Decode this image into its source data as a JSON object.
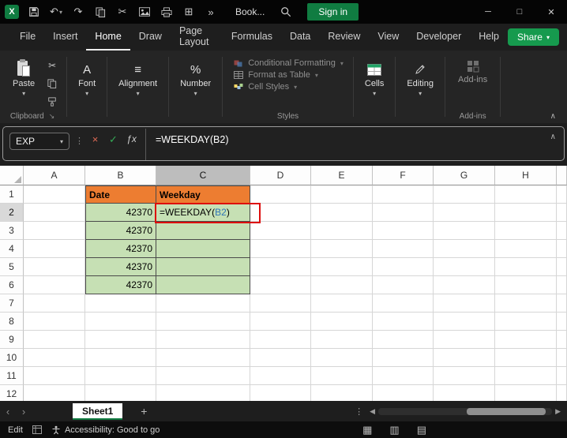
{
  "titlebar": {
    "workbook_name": "Book...",
    "signin_label": "Sign in"
  },
  "menubar": {
    "items": [
      "File",
      "Insert",
      "Home",
      "Draw",
      "Page Layout",
      "Formulas",
      "Data",
      "Review",
      "View",
      "Developer",
      "Help"
    ],
    "active": "Home",
    "share_label": "Share"
  },
  "ribbon": {
    "paste_label": "Paste",
    "clipboard_label": "Clipboard",
    "font_label": "Font",
    "alignment_label": "Alignment",
    "number_label": "Number",
    "styles_items": [
      "Conditional Formatting",
      "Format as Table",
      "Cell Styles"
    ],
    "styles_label": "Styles",
    "cells_label": "Cells",
    "editing_label": "Editing",
    "addins_label": "Add-ins",
    "addins_group_label": "Add-ins"
  },
  "formula_bar": {
    "name_box": "EXP",
    "formula": "=WEEKDAY(B2)"
  },
  "grid": {
    "columns": [
      "A",
      "B",
      "C",
      "D",
      "E",
      "F",
      "G",
      "H"
    ],
    "rows": [
      1,
      2,
      3,
      4,
      5,
      6,
      7,
      8,
      9,
      10,
      11,
      12
    ],
    "active_column": "C",
    "active_row": 2,
    "cells": {
      "B1": {
        "text": "Date",
        "fill": "orange",
        "bold": true
      },
      "C1": {
        "text": "Weekday",
        "fill": "orange",
        "bold": true
      },
      "B2": {
        "text": "42370",
        "fill": "green",
        "align": "right"
      },
      "B3": {
        "text": "42370",
        "fill": "green",
        "align": "right"
      },
      "B4": {
        "text": "42370",
        "fill": "green",
        "align": "right"
      },
      "B5": {
        "text": "42370",
        "fill": "green",
        "align": "right"
      },
      "B6": {
        "text": "42370",
        "fill": "green",
        "align": "right"
      },
      "C2": {
        "fill": "green",
        "formula_parts": {
          "prefix": "=WEEKDAY(",
          "ref": "B2",
          "suffix": ")"
        }
      },
      "C3": {
        "fill": "green"
      },
      "C4": {
        "fill": "green"
      },
      "C5": {
        "fill": "green"
      },
      "C6": {
        "fill": "green"
      }
    }
  },
  "sheet_bar": {
    "active_tab": "Sheet1"
  },
  "status_bar": {
    "mode": "Edit",
    "accessibility": "Accessibility: Good to go"
  },
  "icons": {
    "undo": "↶",
    "redo": "↷",
    "cut": "✂",
    "table_grid": "⊞",
    "overflow": "»",
    "chevron_down": "▾",
    "chevron_up": "∧",
    "dots_v": "⋮",
    "cancel": "×",
    "enter": "✓",
    "fx": "ƒx",
    "nav_left": "‹",
    "nav_right": "›",
    "scroll_left": "◀",
    "scroll_right": "▶",
    "add_sheet": "+",
    "minimize": "─",
    "maximize": "□",
    "close": "✕",
    "align": "≡",
    "percent": "%",
    "font": "A",
    "launcher": "↘",
    "view_normal": "▦",
    "view_page_layout": "▥",
    "view_page_break": "▤",
    "logo": "X"
  },
  "colors": {
    "header_fill": "#ED7D31",
    "data_fill": "#C6E0B4",
    "accent_green": "#107C41",
    "highlight_red": "#DD0D0D",
    "ref_blue": "#2E75B6"
  }
}
